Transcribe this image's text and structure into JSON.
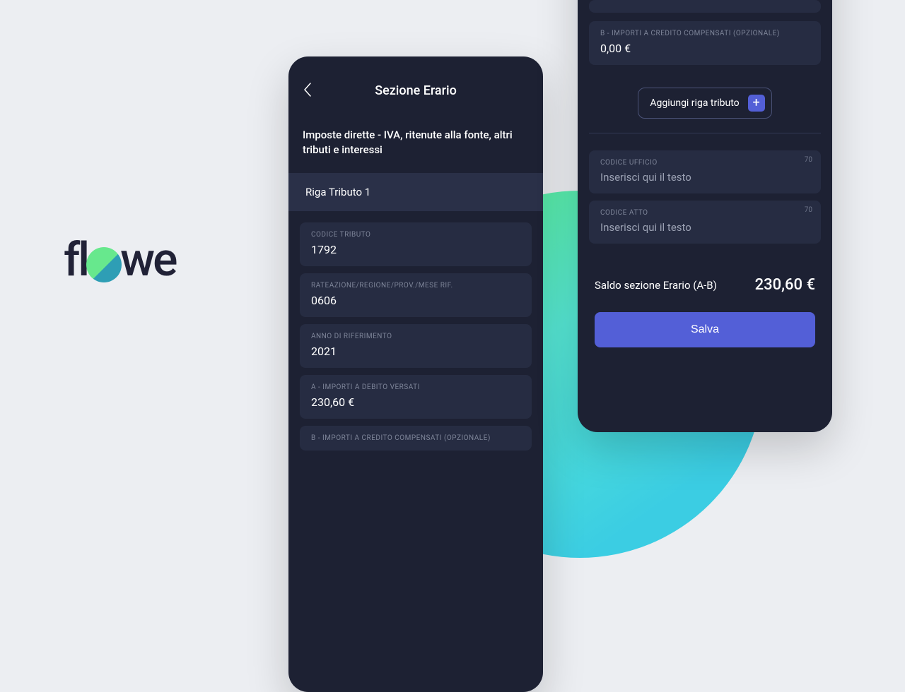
{
  "logo": {
    "pre": "fl",
    "post": "we"
  },
  "left": {
    "title": "Sezione Erario",
    "subtitle": "Imposte dirette - IVA, ritenute alla fonte, altri tributi e interessi",
    "section": "Riga Tributo 1",
    "fields": {
      "codice_tributo": {
        "label": "CODICE TRIBUTO",
        "value": "1792"
      },
      "rateazione": {
        "label": "RATEAZIONE/REGIONE/PROV./MESE RIF.",
        "value": "0606"
      },
      "anno": {
        "label": "ANNO DI RIFERIMENTO",
        "value": "2021"
      },
      "a_debito": {
        "label": "A - IMPORTI A DEBITO VERSATI",
        "value": "230,60 €"
      },
      "b_credito_partial": {
        "label": "B - IMPORTI A CREDITO COMPENSATI (OPZIONALE)"
      }
    }
  },
  "right": {
    "b_credito": {
      "label": "B - IMPORTI A CREDITO COMPENSATI (OPZIONALE)",
      "value": "0,00 €"
    },
    "add_row": "Aggiungi riga tributo",
    "codice_ufficio": {
      "label": "CODICE UFFICIO",
      "placeholder": "Inserisci qui il testo",
      "count": "70"
    },
    "codice_atto": {
      "label": "CODICE ATTO",
      "placeholder": "Inserisci qui il testo",
      "count": "70"
    },
    "balance_label": "Saldo sezione Erario (A-B)",
    "balance_value": "230,60 €",
    "save": "Salva"
  }
}
